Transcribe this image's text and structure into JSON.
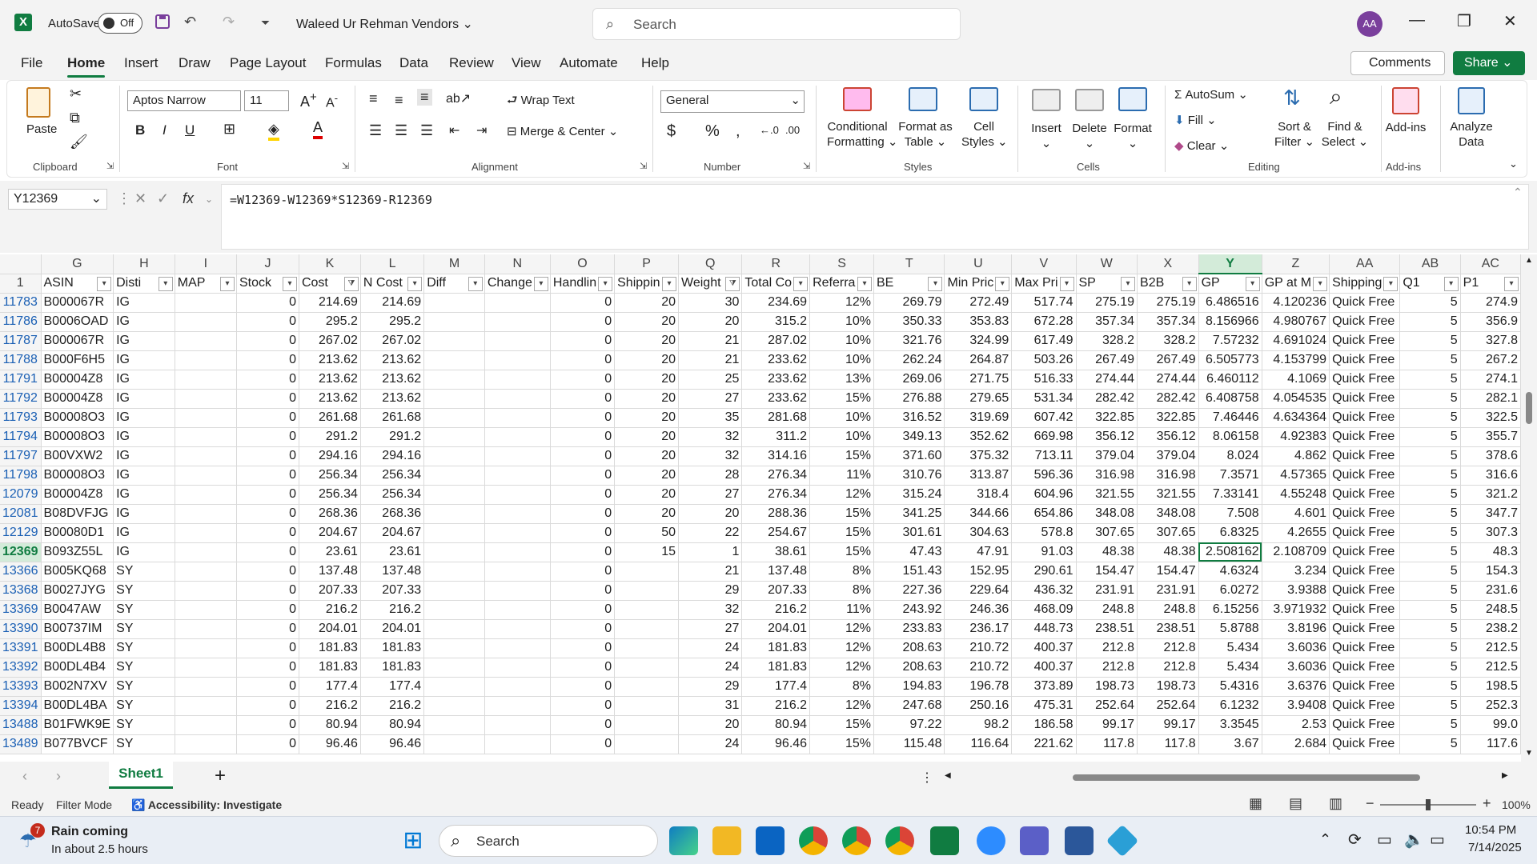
{
  "titlebar": {
    "autosave_label": "AutoSave",
    "autosave_state": "Off",
    "doc_title": "Waleed Ur Rehman Vendors",
    "search_placeholder": "Search",
    "avatar_initials": "AA"
  },
  "menu": [
    "File",
    "Home",
    "Insert",
    "Draw",
    "Page Layout",
    "Formulas",
    "Data",
    "Review",
    "View",
    "Automate",
    "Help"
  ],
  "menu_active": "Home",
  "comments_label": "Comments",
  "share_label": "Share",
  "ribbon": {
    "clipboard": {
      "paste": "Paste",
      "group": "Clipboard"
    },
    "font": {
      "name": "Aptos Narrow",
      "size": "11",
      "group": "Font"
    },
    "alignment": {
      "wrap": "Wrap Text",
      "merge": "Merge & Center",
      "group": "Alignment"
    },
    "number": {
      "format": "General",
      "group": "Number"
    },
    "styles": {
      "cond1": "Conditional",
      "cond2": "Formatting",
      "fat1": "Format as",
      "fat2": "Table",
      "cs1": "Cell",
      "cs2": "Styles",
      "group": "Styles"
    },
    "cells": {
      "insert": "Insert",
      "delete": "Delete",
      "format": "Format",
      "group": "Cells"
    },
    "editing": {
      "autosum": "AutoSum",
      "fill": "Fill",
      "clear": "Clear",
      "sort1": "Sort &",
      "sort2": "Filter",
      "find1": "Find &",
      "find2": "Select",
      "group": "Editing"
    },
    "addins": {
      "addins1": "Add-ins",
      "group": "Add-ins",
      "analyze1": "Analyze",
      "analyze2": "Data"
    }
  },
  "formula_bar": {
    "name_box": "Y12369",
    "formula": "=W12369-W12369*S12369-R12369"
  },
  "columns": [
    "G",
    "H",
    "I",
    "J",
    "K",
    "L",
    "M",
    "N",
    "O",
    "P",
    "Q",
    "R",
    "S",
    "T",
    "U",
    "V",
    "W",
    "X",
    "Y",
    "Z",
    "AA",
    "AB",
    "AC"
  ],
  "selected_column": "Y",
  "header_row": {
    "row_num": "1",
    "cells": [
      "ASIN",
      "Disti",
      "MAP",
      "Stock",
      "Cost",
      "N Cost",
      "Diff",
      "Change",
      "Handlin",
      "Shippin",
      "Weight",
      "Total Co",
      "Referra",
      "BE",
      "Min Pric",
      "Max Pri",
      "SP",
      "B2B",
      "GP",
      "GP at M",
      "Shipping",
      "Q1",
      "P1"
    ]
  },
  "rows": [
    {
      "n": "11783",
      "c": [
        "B000067R",
        "IG",
        "",
        "0",
        "214.69",
        "214.69",
        "",
        "",
        "0",
        "20",
        "30",
        "234.69",
        "12%",
        "269.79",
        "272.49",
        "517.74",
        "275.19",
        "275.19",
        "6.486516",
        "4.120236",
        "Quick Free",
        "5",
        "274.9"
      ]
    },
    {
      "n": "11786",
      "c": [
        "B0006OAD",
        "IG",
        "",
        "0",
        "295.2",
        "295.2",
        "",
        "",
        "0",
        "20",
        "20",
        "315.2",
        "10%",
        "350.33",
        "353.83",
        "672.28",
        "357.34",
        "357.34",
        "8.156966",
        "4.980767",
        "Quick Free",
        "5",
        "356.9"
      ]
    },
    {
      "n": "11787",
      "c": [
        "B000067R",
        "IG",
        "",
        "0",
        "267.02",
        "267.02",
        "",
        "",
        "0",
        "20",
        "21",
        "287.02",
        "10%",
        "321.76",
        "324.99",
        "617.49",
        "328.2",
        "328.2",
        "7.57232",
        "4.691024",
        "Quick Free",
        "5",
        "327.8"
      ]
    },
    {
      "n": "11788",
      "c": [
        "B000F6H5",
        "IG",
        "",
        "0",
        "213.62",
        "213.62",
        "",
        "",
        "0",
        "20",
        "21",
        "233.62",
        "10%",
        "262.24",
        "264.87",
        "503.26",
        "267.49",
        "267.49",
        "6.505773",
        "4.153799",
        "Quick Free",
        "5",
        "267.2"
      ]
    },
    {
      "n": "11791",
      "c": [
        "B00004Z8",
        "IG",
        "",
        "0",
        "213.62",
        "213.62",
        "",
        "",
        "0",
        "20",
        "25",
        "233.62",
        "13%",
        "269.06",
        "271.75",
        "516.33",
        "274.44",
        "274.44",
        "6.460112",
        "4.1069",
        "Quick Free",
        "5",
        "274.1"
      ]
    },
    {
      "n": "11792",
      "c": [
        "B00004Z8",
        "IG",
        "",
        "0",
        "213.62",
        "213.62",
        "",
        "",
        "0",
        "20",
        "27",
        "233.62",
        "15%",
        "276.88",
        "279.65",
        "531.34",
        "282.42",
        "282.42",
        "6.408758",
        "4.054535",
        "Quick Free",
        "5",
        "282.1"
      ]
    },
    {
      "n": "11793",
      "c": [
        "B00008O3",
        "IG",
        "",
        "0",
        "261.68",
        "261.68",
        "",
        "",
        "0",
        "20",
        "35",
        "281.68",
        "10%",
        "316.52",
        "319.69",
        "607.42",
        "322.85",
        "322.85",
        "7.46446",
        "4.634364",
        "Quick Free",
        "5",
        "322.5"
      ]
    },
    {
      "n": "11794",
      "c": [
        "B00008O3",
        "IG",
        "",
        "0",
        "291.2",
        "291.2",
        "",
        "",
        "0",
        "20",
        "32",
        "311.2",
        "10%",
        "349.13",
        "352.62",
        "669.98",
        "356.12",
        "356.12",
        "8.06158",
        "4.92383",
        "Quick Free",
        "5",
        "355.7"
      ]
    },
    {
      "n": "11797",
      "c": [
        "B00VXW2",
        "IG",
        "",
        "0",
        "294.16",
        "294.16",
        "",
        "",
        "0",
        "20",
        "32",
        "314.16",
        "15%",
        "371.60",
        "375.32",
        "713.11",
        "379.04",
        "379.04",
        "8.024",
        "4.862",
        "Quick Free",
        "5",
        "378.6"
      ]
    },
    {
      "n": "11798",
      "c": [
        "B00008O3",
        "IG",
        "",
        "0",
        "256.34",
        "256.34",
        "",
        "",
        "0",
        "20",
        "28",
        "276.34",
        "11%",
        "310.76",
        "313.87",
        "596.36",
        "316.98",
        "316.98",
        "7.3571",
        "4.57365",
        "Quick Free",
        "5",
        "316.6"
      ]
    },
    {
      "n": "12079",
      "c": [
        "B00004Z8",
        "IG",
        "",
        "0",
        "256.34",
        "256.34",
        "",
        "",
        "0",
        "20",
        "27",
        "276.34",
        "12%",
        "315.24",
        "318.4",
        "604.96",
        "321.55",
        "321.55",
        "7.33141",
        "4.55248",
        "Quick Free",
        "5",
        "321.2"
      ]
    },
    {
      "n": "12081",
      "c": [
        "B08DVFJG",
        "IG",
        "",
        "0",
        "268.36",
        "268.36",
        "",
        "",
        "0",
        "20",
        "20",
        "288.36",
        "15%",
        "341.25",
        "344.66",
        "654.86",
        "348.08",
        "348.08",
        "7.508",
        "4.601",
        "Quick Free",
        "5",
        "347.7"
      ]
    },
    {
      "n": "12129",
      "c": [
        "B00080D1",
        "IG",
        "",
        "0",
        "204.67",
        "204.67",
        "",
        "",
        "0",
        "50",
        "22",
        "254.67",
        "15%",
        "301.61",
        "304.63",
        "578.8",
        "307.65",
        "307.65",
        "6.8325",
        "4.2655",
        "Quick Free",
        "5",
        "307.3"
      ]
    },
    {
      "n": "12369",
      "c": [
        "B093Z55L",
        "IG",
        "",
        "0",
        "23.61",
        "23.61",
        "",
        "",
        "0",
        "15",
        "1",
        "38.61",
        "15%",
        "47.43",
        "47.91",
        "91.03",
        "48.38",
        "48.38",
        "2.508162",
        "2.108709",
        "Quick Free",
        "5",
        "48.3"
      ]
    },
    {
      "n": "13366",
      "c": [
        "B005KQ68",
        "SY",
        "",
        "0",
        "137.48",
        "137.48",
        "",
        "",
        "0",
        "",
        "21",
        "137.48",
        "8%",
        "151.43",
        "152.95",
        "290.61",
        "154.47",
        "154.47",
        "4.6324",
        "3.234",
        "Quick Free",
        "5",
        "154.3"
      ]
    },
    {
      "n": "13368",
      "c": [
        "B0027JYG",
        "SY",
        "",
        "0",
        "207.33",
        "207.33",
        "",
        "",
        "0",
        "",
        "29",
        "207.33",
        "8%",
        "227.36",
        "229.64",
        "436.32",
        "231.91",
        "231.91",
        "6.0272",
        "3.9388",
        "Quick Free",
        "5",
        "231.6"
      ]
    },
    {
      "n": "13369",
      "c": [
        "B0047AW",
        "SY",
        "",
        "0",
        "216.2",
        "216.2",
        "",
        "",
        "0",
        "",
        "32",
        "216.2",
        "11%",
        "243.92",
        "246.36",
        "468.09",
        "248.8",
        "248.8",
        "6.15256",
        "3.971932",
        "Quick Free",
        "5",
        "248.5"
      ]
    },
    {
      "n": "13390",
      "c": [
        "B00737IM",
        "SY",
        "",
        "0",
        "204.01",
        "204.01",
        "",
        "",
        "0",
        "",
        "27",
        "204.01",
        "12%",
        "233.83",
        "236.17",
        "448.73",
        "238.51",
        "238.51",
        "5.8788",
        "3.8196",
        "Quick Free",
        "5",
        "238.2"
      ]
    },
    {
      "n": "13391",
      "c": [
        "B00DL4B8",
        "SY",
        "",
        "0",
        "181.83",
        "181.83",
        "",
        "",
        "0",
        "",
        "24",
        "181.83",
        "12%",
        "208.63",
        "210.72",
        "400.37",
        "212.8",
        "212.8",
        "5.434",
        "3.6036",
        "Quick Free",
        "5",
        "212.5"
      ]
    },
    {
      "n": "13392",
      "c": [
        "B00DL4B4",
        "SY",
        "",
        "0",
        "181.83",
        "181.83",
        "",
        "",
        "0",
        "",
        "24",
        "181.83",
        "12%",
        "208.63",
        "210.72",
        "400.37",
        "212.8",
        "212.8",
        "5.434",
        "3.6036",
        "Quick Free",
        "5",
        "212.5"
      ]
    },
    {
      "n": "13393",
      "c": [
        "B002N7XV",
        "SY",
        "",
        "0",
        "177.4",
        "177.4",
        "",
        "",
        "0",
        "",
        "29",
        "177.4",
        "8%",
        "194.83",
        "196.78",
        "373.89",
        "198.73",
        "198.73",
        "5.4316",
        "3.6376",
        "Quick Free",
        "5",
        "198.5"
      ]
    },
    {
      "n": "13394",
      "c": [
        "B00DL4BA",
        "SY",
        "",
        "0",
        "216.2",
        "216.2",
        "",
        "",
        "0",
        "",
        "31",
        "216.2",
        "12%",
        "247.68",
        "250.16",
        "475.31",
        "252.64",
        "252.64",
        "6.1232",
        "3.9408",
        "Quick Free",
        "5",
        "252.3"
      ]
    },
    {
      "n": "13488",
      "c": [
        "B01FWK9E",
        "SY",
        "",
        "0",
        "80.94",
        "80.94",
        "",
        "",
        "0",
        "",
        "20",
        "80.94",
        "15%",
        "97.22",
        "98.2",
        "186.58",
        "99.17",
        "99.17",
        "3.3545",
        "2.53",
        "Quick Free",
        "5",
        "99.0"
      ]
    },
    {
      "n": "13489",
      "c": [
        "B077BVCF",
        "SY",
        "",
        "0",
        "96.46",
        "96.46",
        "",
        "",
        "0",
        "",
        "24",
        "96.46",
        "15%",
        "115.48",
        "116.64",
        "221.62",
        "117.8",
        "117.8",
        "3.67",
        "2.684",
        "Quick Free",
        "5",
        "117.6"
      ]
    }
  ],
  "selected_row": "12369",
  "sheet_tab": "Sheet1",
  "status": {
    "ready": "Ready",
    "filter_mode": "Filter Mode",
    "accessibility": "Accessibility: Investigate",
    "zoom": "100%"
  },
  "taskbar": {
    "weather_title": "Rain coming",
    "weather_sub": "In about 2.5 hours",
    "weather_badge": "7",
    "search": "Search",
    "time": "10:54 PM",
    "date": "7/14/2025"
  }
}
